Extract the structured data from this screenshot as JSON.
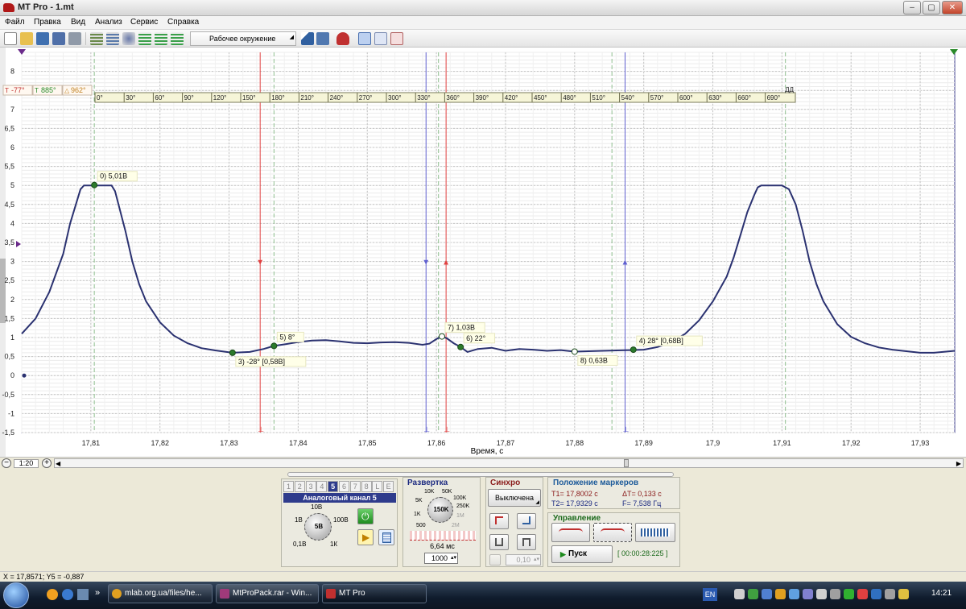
{
  "window": {
    "title": "MT Pro - 1.mt",
    "buttons": [
      "–",
      "▢",
      "✕"
    ]
  },
  "menu": [
    "Файл",
    "Правка",
    "Вид",
    "Анализ",
    "Сервис",
    "Справка"
  ],
  "toolbar": {
    "environment_label": "Рабочее окружение"
  },
  "chart_data": {
    "type": "line",
    "xlabel": "Время, с",
    "ylabel": "",
    "xlim": [
      17.8,
      17.935
    ],
    "ylim": [
      -1.5,
      8.5
    ],
    "x_ticks": [
      "17,81",
      "17,82",
      "17,83",
      "17,84",
      "17,85",
      "17,86",
      "17,87",
      "17,88",
      "17,89",
      "17,9",
      "17,91",
      "17,92",
      "17,93"
    ],
    "x_tick_values": [
      17.81,
      17.82,
      17.83,
      17.84,
      17.85,
      17.86,
      17.87,
      17.88,
      17.89,
      17.9,
      17.91,
      17.92,
      17.93
    ],
    "y_ticks": [
      "8",
      "7,5",
      "7",
      "6,5",
      "6",
      "5,5",
      "5",
      "4,5",
      "4",
      "3,5",
      "3",
      "2,5",
      "2",
      "1,5",
      "1",
      "0,5",
      "0",
      "-0,5",
      "-1",
      "-1,5"
    ],
    "y_tick_values": [
      8,
      7.5,
      7,
      6.5,
      6,
      5.5,
      5,
      4.5,
      4,
      3.5,
      3,
      2.5,
      2,
      1.5,
      1,
      0.5,
      0,
      -0.5,
      -1,
      -1.5
    ],
    "grid": true,
    "series": [
      {
        "color": "#2a3170",
        "points": [
          [
            17.8,
            1.1
          ],
          [
            17.802,
            1.5
          ],
          [
            17.804,
            2.2
          ],
          [
            17.806,
            3.2
          ],
          [
            17.807,
            4.0
          ],
          [
            17.808,
            4.6
          ],
          [
            17.8085,
            4.9
          ],
          [
            17.809,
            5.0
          ],
          [
            17.812,
            5.0
          ],
          [
            17.813,
            5.0
          ],
          [
            17.8135,
            4.85
          ],
          [
            17.814,
            4.5
          ],
          [
            17.815,
            3.8
          ],
          [
            17.816,
            3.0
          ],
          [
            17.817,
            2.4
          ],
          [
            17.818,
            1.95
          ],
          [
            17.82,
            1.4
          ],
          [
            17.822,
            1.05
          ],
          [
            17.824,
            0.85
          ],
          [
            17.826,
            0.72
          ],
          [
            17.828,
            0.66
          ],
          [
            17.8305,
            0.6
          ],
          [
            17.833,
            0.62
          ],
          [
            17.835,
            0.7
          ],
          [
            17.8365,
            0.78
          ],
          [
            17.838,
            0.82
          ],
          [
            17.84,
            0.88
          ],
          [
            17.842,
            0.92
          ],
          [
            17.844,
            0.93
          ],
          [
            17.846,
            0.9
          ],
          [
            17.848,
            0.86
          ],
          [
            17.85,
            0.85
          ],
          [
            17.852,
            0.87
          ],
          [
            17.854,
            0.88
          ],
          [
            17.856,
            0.86
          ],
          [
            17.858,
            0.81
          ],
          [
            17.859,
            0.84
          ],
          [
            17.86,
            0.96
          ],
          [
            17.8608,
            1.03
          ],
          [
            17.8615,
            0.98
          ],
          [
            17.8625,
            0.85
          ],
          [
            17.8635,
            0.75
          ],
          [
            17.8645,
            0.62
          ],
          [
            17.866,
            0.7
          ],
          [
            17.868,
            0.73
          ],
          [
            17.87,
            0.65
          ],
          [
            17.872,
            0.7
          ],
          [
            17.874,
            0.68
          ],
          [
            17.876,
            0.65
          ],
          [
            17.878,
            0.67
          ],
          [
            17.88,
            0.63
          ],
          [
            17.882,
            0.64
          ],
          [
            17.884,
            0.65
          ],
          [
            17.886,
            0.66
          ],
          [
            17.888,
            0.67
          ],
          [
            17.89,
            0.68
          ],
          [
            17.892,
            0.75
          ],
          [
            17.894,
            0.88
          ],
          [
            17.896,
            1.1
          ],
          [
            17.898,
            1.45
          ],
          [
            17.9,
            1.95
          ],
          [
            17.902,
            2.6
          ],
          [
            17.903,
            3.1
          ],
          [
            17.904,
            3.7
          ],
          [
            17.905,
            4.3
          ],
          [
            17.906,
            4.75
          ],
          [
            17.9065,
            4.95
          ],
          [
            17.907,
            5.0
          ],
          [
            17.91,
            5.0
          ],
          [
            17.911,
            4.9
          ],
          [
            17.912,
            4.5
          ],
          [
            17.913,
            3.8
          ],
          [
            17.914,
            3.0
          ],
          [
            17.915,
            2.4
          ],
          [
            17.916,
            1.95
          ],
          [
            17.918,
            1.35
          ],
          [
            17.92,
            1.02
          ],
          [
            17.922,
            0.85
          ],
          [
            17.924,
            0.74
          ],
          [
            17.926,
            0.68
          ],
          [
            17.928,
            0.64
          ],
          [
            17.93,
            0.6
          ],
          [
            17.932,
            0.6
          ],
          [
            17.935,
            0.65
          ]
        ]
      }
    ],
    "annotations": [
      {
        "x": 17.8105,
        "y": 5.01,
        "text": "0) 5,01В",
        "fill": "#2b7a2b"
      },
      {
        "x": 17.8305,
        "y": 0.6,
        "text": "3) -28° [0,58В]",
        "fill": "#2b7a2b"
      },
      {
        "x": 17.8365,
        "y": 0.78,
        "text": "5) 8°",
        "fill": "#2b7a2b"
      },
      {
        "x": 17.8608,
        "y": 1.03,
        "text": "7) 1,03В",
        "fill": "#ffffff"
      },
      {
        "x": 17.8635,
        "y": 0.75,
        "text": "6) 22°",
        "fill": "#2b7a2b"
      },
      {
        "x": 17.88,
        "y": 0.63,
        "text": "8) 0,63В",
        "fill": "#ffffff"
      },
      {
        "x": 17.8885,
        "y": 0.68,
        "text": "4) 28° [0,68В]",
        "fill": "#2b7a2b"
      }
    ],
    "markers": [
      {
        "x": 17.8345,
        "color": "#e04040",
        "symbol": "▼"
      },
      {
        "x": 17.8585,
        "color": "#6060d0",
        "symbol": "▼"
      },
      {
        "x": 17.8614,
        "color": "#e04040",
        "symbol": "▲"
      },
      {
        "x": 17.8873,
        "color": "#6060d0",
        "symbol": "▲"
      }
    ],
    "dashed_markers": [
      17.8105,
      17.8365,
      17.8603,
      17.8854,
      17.9105
    ],
    "phase_scale": [
      "0°",
      "30°",
      "60°",
      "90°",
      "120°",
      "150°",
      "180°",
      "210°",
      "240°",
      "270°",
      "300°",
      "330°",
      "360°",
      "390°",
      "420°",
      "450°",
      "480°",
      "510°",
      "540°",
      "570°",
      "600°",
      "630°",
      "660°",
      "690°"
    ],
    "phase_end_label": "ДД",
    "corner_badges": [
      "-77°",
      "885°",
      "962°"
    ]
  },
  "scroll": {
    "minus": "−",
    "scale": "1:20",
    "plus": "+"
  },
  "channel_panel": {
    "tabs": [
      "1",
      "2",
      "3",
      "4",
      "5",
      "6",
      "7",
      "8",
      "L",
      "E"
    ],
    "active_tab": "5",
    "title": "Аналоговый канал 5",
    "knob_labels": [
      "10В",
      "1В",
      "100В",
      "0,1В",
      "1К"
    ],
    "knob_value": "5В"
  },
  "sweep_panel": {
    "title": "Развертка",
    "knob_labels": [
      "10K",
      "50K",
      "5K",
      "100K",
      "1K",
      "250K",
      "500",
      "2M",
      "1M"
    ],
    "knob_value": "150K",
    "interval": "6,64 мс",
    "samples": "1000"
  },
  "sync_panel": {
    "title": "Синхро",
    "mode": "Выключена",
    "level": "0,10"
  },
  "markers_panel": {
    "title": "Положение маркеров",
    "t1": "T1= 17,8002 с",
    "t2": "T2= 17,9329 с",
    "dt": "ΔT= 0,133 с",
    "freq": "F= 7,538 Гц"
  },
  "control_panel": {
    "title": "Управление",
    "start_label": "Пуск",
    "elapsed": "[ 00:00:28:225 ]"
  },
  "status": {
    "cursor": "X = 17,8571; Y5 = -0,887"
  },
  "taskbar": {
    "items": [
      "mlab.org.ua/files/he...",
      "MtProPack.rar - Win...",
      "MT Pro"
    ],
    "lang": "EN",
    "clock": "14:21"
  },
  "colors": {
    "signal": "#2a3170",
    "marker_red": "#e04040",
    "marker_blue": "#6060d0",
    "dashed_green": "#8fbf8f",
    "accent_channel": "#2e3b8c"
  }
}
